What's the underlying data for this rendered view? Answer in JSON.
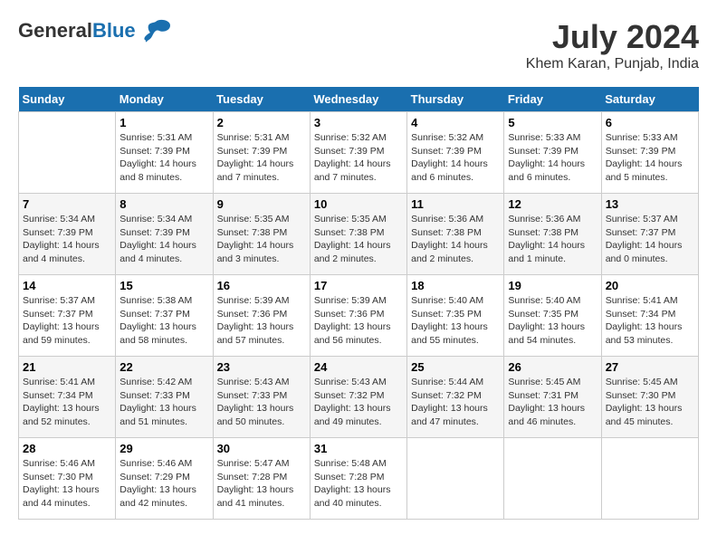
{
  "header": {
    "logo_general": "General",
    "logo_blue": "Blue",
    "month_title": "July 2024",
    "location": "Khem Karan, Punjab, India"
  },
  "weekdays": [
    "Sunday",
    "Monday",
    "Tuesday",
    "Wednesday",
    "Thursday",
    "Friday",
    "Saturday"
  ],
  "weeks": [
    [
      {
        "day": "",
        "sunrise": "",
        "sunset": "",
        "daylight": ""
      },
      {
        "day": "1",
        "sunrise": "Sunrise: 5:31 AM",
        "sunset": "Sunset: 7:39 PM",
        "daylight": "Daylight: 14 hours and 8 minutes."
      },
      {
        "day": "2",
        "sunrise": "Sunrise: 5:31 AM",
        "sunset": "Sunset: 7:39 PM",
        "daylight": "Daylight: 14 hours and 7 minutes."
      },
      {
        "day": "3",
        "sunrise": "Sunrise: 5:32 AM",
        "sunset": "Sunset: 7:39 PM",
        "daylight": "Daylight: 14 hours and 7 minutes."
      },
      {
        "day": "4",
        "sunrise": "Sunrise: 5:32 AM",
        "sunset": "Sunset: 7:39 PM",
        "daylight": "Daylight: 14 hours and 6 minutes."
      },
      {
        "day": "5",
        "sunrise": "Sunrise: 5:33 AM",
        "sunset": "Sunset: 7:39 PM",
        "daylight": "Daylight: 14 hours and 6 minutes."
      },
      {
        "day": "6",
        "sunrise": "Sunrise: 5:33 AM",
        "sunset": "Sunset: 7:39 PM",
        "daylight": "Daylight: 14 hours and 5 minutes."
      }
    ],
    [
      {
        "day": "7",
        "sunrise": "Sunrise: 5:34 AM",
        "sunset": "Sunset: 7:39 PM",
        "daylight": "Daylight: 14 hours and 4 minutes."
      },
      {
        "day": "8",
        "sunrise": "Sunrise: 5:34 AM",
        "sunset": "Sunset: 7:39 PM",
        "daylight": "Daylight: 14 hours and 4 minutes."
      },
      {
        "day": "9",
        "sunrise": "Sunrise: 5:35 AM",
        "sunset": "Sunset: 7:38 PM",
        "daylight": "Daylight: 14 hours and 3 minutes."
      },
      {
        "day": "10",
        "sunrise": "Sunrise: 5:35 AM",
        "sunset": "Sunset: 7:38 PM",
        "daylight": "Daylight: 14 hours and 2 minutes."
      },
      {
        "day": "11",
        "sunrise": "Sunrise: 5:36 AM",
        "sunset": "Sunset: 7:38 PM",
        "daylight": "Daylight: 14 hours and 2 minutes."
      },
      {
        "day": "12",
        "sunrise": "Sunrise: 5:36 AM",
        "sunset": "Sunset: 7:38 PM",
        "daylight": "Daylight: 14 hours and 1 minute."
      },
      {
        "day": "13",
        "sunrise": "Sunrise: 5:37 AM",
        "sunset": "Sunset: 7:37 PM",
        "daylight": "Daylight: 14 hours and 0 minutes."
      }
    ],
    [
      {
        "day": "14",
        "sunrise": "Sunrise: 5:37 AM",
        "sunset": "Sunset: 7:37 PM",
        "daylight": "Daylight: 13 hours and 59 minutes."
      },
      {
        "day": "15",
        "sunrise": "Sunrise: 5:38 AM",
        "sunset": "Sunset: 7:37 PM",
        "daylight": "Daylight: 13 hours and 58 minutes."
      },
      {
        "day": "16",
        "sunrise": "Sunrise: 5:39 AM",
        "sunset": "Sunset: 7:36 PM",
        "daylight": "Daylight: 13 hours and 57 minutes."
      },
      {
        "day": "17",
        "sunrise": "Sunrise: 5:39 AM",
        "sunset": "Sunset: 7:36 PM",
        "daylight": "Daylight: 13 hours and 56 minutes."
      },
      {
        "day": "18",
        "sunrise": "Sunrise: 5:40 AM",
        "sunset": "Sunset: 7:35 PM",
        "daylight": "Daylight: 13 hours and 55 minutes."
      },
      {
        "day": "19",
        "sunrise": "Sunrise: 5:40 AM",
        "sunset": "Sunset: 7:35 PM",
        "daylight": "Daylight: 13 hours and 54 minutes."
      },
      {
        "day": "20",
        "sunrise": "Sunrise: 5:41 AM",
        "sunset": "Sunset: 7:34 PM",
        "daylight": "Daylight: 13 hours and 53 minutes."
      }
    ],
    [
      {
        "day": "21",
        "sunrise": "Sunrise: 5:41 AM",
        "sunset": "Sunset: 7:34 PM",
        "daylight": "Daylight: 13 hours and 52 minutes."
      },
      {
        "day": "22",
        "sunrise": "Sunrise: 5:42 AM",
        "sunset": "Sunset: 7:33 PM",
        "daylight": "Daylight: 13 hours and 51 minutes."
      },
      {
        "day": "23",
        "sunrise": "Sunrise: 5:43 AM",
        "sunset": "Sunset: 7:33 PM",
        "daylight": "Daylight: 13 hours and 50 minutes."
      },
      {
        "day": "24",
        "sunrise": "Sunrise: 5:43 AM",
        "sunset": "Sunset: 7:32 PM",
        "daylight": "Daylight: 13 hours and 49 minutes."
      },
      {
        "day": "25",
        "sunrise": "Sunrise: 5:44 AM",
        "sunset": "Sunset: 7:32 PM",
        "daylight": "Daylight: 13 hours and 47 minutes."
      },
      {
        "day": "26",
        "sunrise": "Sunrise: 5:45 AM",
        "sunset": "Sunset: 7:31 PM",
        "daylight": "Daylight: 13 hours and 46 minutes."
      },
      {
        "day": "27",
        "sunrise": "Sunrise: 5:45 AM",
        "sunset": "Sunset: 7:30 PM",
        "daylight": "Daylight: 13 hours and 45 minutes."
      }
    ],
    [
      {
        "day": "28",
        "sunrise": "Sunrise: 5:46 AM",
        "sunset": "Sunset: 7:30 PM",
        "daylight": "Daylight: 13 hours and 44 minutes."
      },
      {
        "day": "29",
        "sunrise": "Sunrise: 5:46 AM",
        "sunset": "Sunset: 7:29 PM",
        "daylight": "Daylight: 13 hours and 42 minutes."
      },
      {
        "day": "30",
        "sunrise": "Sunrise: 5:47 AM",
        "sunset": "Sunset: 7:28 PM",
        "daylight": "Daylight: 13 hours and 41 minutes."
      },
      {
        "day": "31",
        "sunrise": "Sunrise: 5:48 AM",
        "sunset": "Sunset: 7:28 PM",
        "daylight": "Daylight: 13 hours and 40 minutes."
      },
      {
        "day": "",
        "sunrise": "",
        "sunset": "",
        "daylight": ""
      },
      {
        "day": "",
        "sunrise": "",
        "sunset": "",
        "daylight": ""
      },
      {
        "day": "",
        "sunrise": "",
        "sunset": "",
        "daylight": ""
      }
    ]
  ]
}
